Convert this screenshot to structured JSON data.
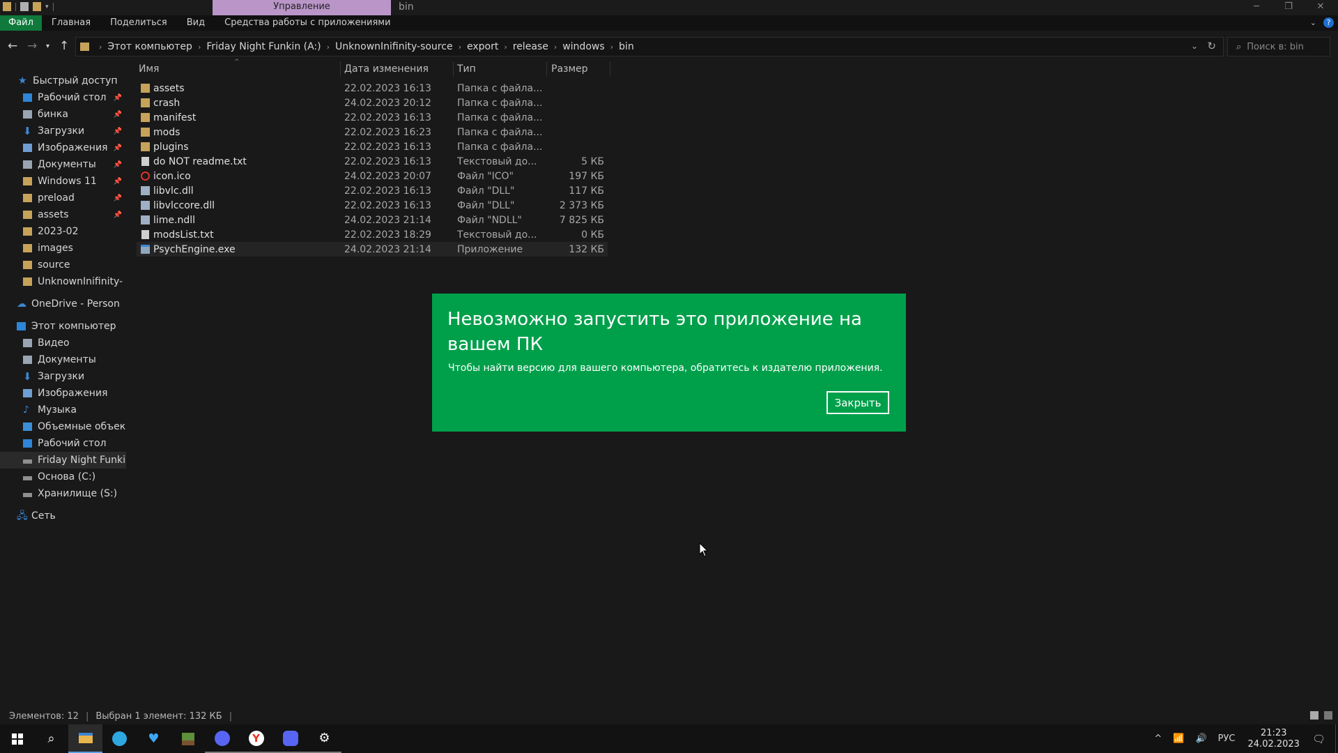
{
  "titlebar": {
    "context_tab": "Управление",
    "window_title": "bin",
    "minimize": "─",
    "maximize": "❐",
    "close": "✕"
  },
  "ribbon": {
    "tabs": [
      "Файл",
      "Главная",
      "Поделиться",
      "Вид",
      "Средства работы с приложениями"
    ]
  },
  "address": {
    "crumbs": [
      "Этот компьютер",
      "Friday Night Funkin (A:)",
      "UnknownInifinity-source",
      "export",
      "release",
      "windows",
      "bin"
    ],
    "search_placeholder": "Поиск в: bin"
  },
  "nav": {
    "quick_access": "Быстрый доступ",
    "quick_items": [
      "Рабочий стол",
      "бинка",
      "Загрузки",
      "Изображения",
      "Документы",
      "Windows 11",
      "preload",
      "assets",
      "2023-02",
      "images",
      "source",
      "UnknownInifinity-"
    ],
    "onedrive": "OneDrive - Person",
    "this_pc": "Этот компьютер",
    "pc_items": [
      "Видео",
      "Документы",
      "Загрузки",
      "Изображения",
      "Музыка",
      "Объемные объек",
      "Рабочий стол",
      "Friday Night Funki",
      "Основа (C:)",
      "Хранилище (S:)"
    ],
    "network": "Сеть"
  },
  "columns": {
    "name": "Имя",
    "date": "Дата изменения",
    "type": "Тип",
    "size": "Размер"
  },
  "files": [
    {
      "name": "assets",
      "date": "22.02.2023 16:13",
      "type": "Папка с файла...",
      "size": "",
      "icon": "folder-icon"
    },
    {
      "name": "crash",
      "date": "24.02.2023 20:12",
      "type": "Папка с файла...",
      "size": "",
      "icon": "folder-icon"
    },
    {
      "name": "manifest",
      "date": "22.02.2023 16:13",
      "type": "Папка с файла...",
      "size": "",
      "icon": "folder-icon"
    },
    {
      "name": "mods",
      "date": "22.02.2023 16:23",
      "type": "Папка с файла...",
      "size": "",
      "icon": "folder-icon"
    },
    {
      "name": "plugins",
      "date": "22.02.2023 16:13",
      "type": "Папка с файла...",
      "size": "",
      "icon": "folder-icon"
    },
    {
      "name": "do NOT readme.txt",
      "date": "22.02.2023 16:13",
      "type": "Текстовый до...",
      "size": "5 КБ",
      "icon": "text-file-icon"
    },
    {
      "name": "icon.ico",
      "date": "24.02.2023 20:07",
      "type": "Файл \"ICO\"",
      "size": "197 КБ",
      "icon": "ico-file-icon"
    },
    {
      "name": "libvlc.dll",
      "date": "22.02.2023 16:13",
      "type": "Файл \"DLL\"",
      "size": "117 КБ",
      "icon": "dll-file-icon"
    },
    {
      "name": "libvlccore.dll",
      "date": "22.02.2023 16:13",
      "type": "Файл \"DLL\"",
      "size": "2 373 КБ",
      "icon": "dll-file-icon"
    },
    {
      "name": "lime.ndll",
      "date": "24.02.2023 21:14",
      "type": "Файл \"NDLL\"",
      "size": "7 825 КБ",
      "icon": "dll-file-icon"
    },
    {
      "name": "modsList.txt",
      "date": "22.02.2023 18:29",
      "type": "Текстовый до...",
      "size": "0 КБ",
      "icon": "text-file-icon"
    },
    {
      "name": "PsychEngine.exe",
      "date": "24.02.2023 21:14",
      "type": "Приложение",
      "size": "132 КБ",
      "icon": "exe-file-icon"
    }
  ],
  "dialog": {
    "title": "Невозможно запустить это приложение на вашем ПК",
    "text": "Чтобы найти версию для вашего компьютера, обратитесь к издателю приложения.",
    "close_label": "Закрыть",
    "color": "#00a04b"
  },
  "status": {
    "count": "Элементов: 12",
    "selected": "Выбран 1 элемент: 132 КБ"
  },
  "tray": {
    "lang": "РУС",
    "time": "21:23",
    "date": "24.02.2023"
  },
  "colors": {
    "accent_green": "#0f7a3b",
    "context_tab": "#b995c8",
    "folder": "#c7a35a"
  }
}
